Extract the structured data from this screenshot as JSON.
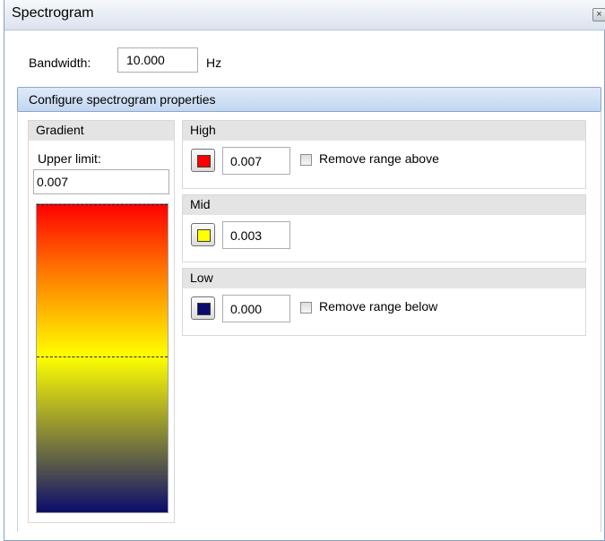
{
  "window": {
    "title": "Spectrogram",
    "close_icon": "close-icon"
  },
  "bandwidth": {
    "label": "Bandwidth:",
    "value": "10.000",
    "unit": "Hz"
  },
  "config": {
    "title": "Configure spectrogram properties"
  },
  "gradient": {
    "header": "Gradient",
    "upper_label": "Upper limit:",
    "upper_value": "0.007"
  },
  "high": {
    "header": "High",
    "color": "#ff0000",
    "value": "0.007",
    "remove_label": "Remove range above",
    "remove_checked": false
  },
  "mid": {
    "header": "Mid",
    "color": "#ffff00",
    "value": "0.003"
  },
  "low": {
    "header": "Low",
    "color": "#0b0b6e",
    "value": "0.000",
    "remove_label": "Remove range below",
    "remove_checked": false
  }
}
